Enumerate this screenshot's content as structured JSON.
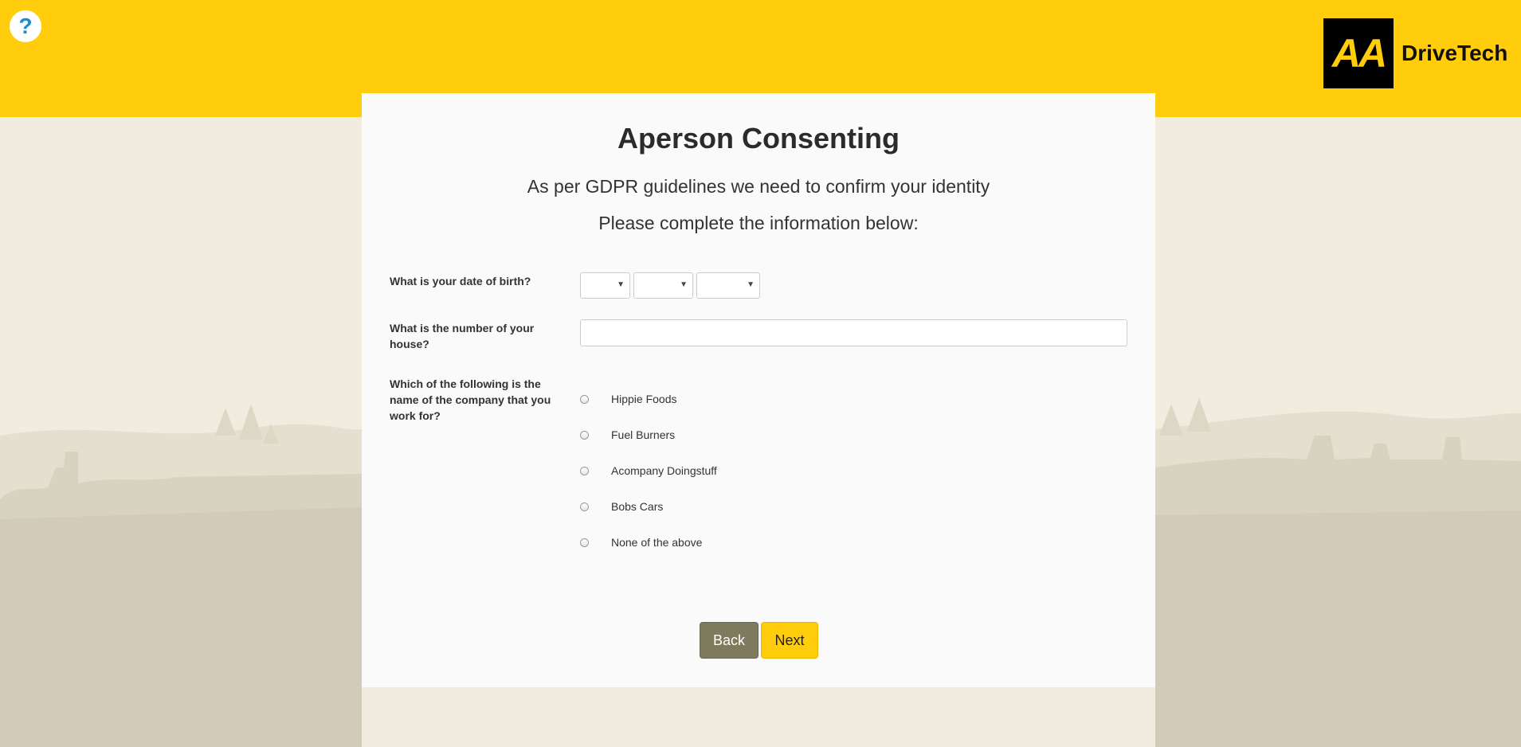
{
  "header": {
    "help_glyph": "?",
    "logo_mark": "AA",
    "logo_text": "DriveTech",
    "brand_color": "#ffcd0c"
  },
  "form": {
    "title": "Aperson Consenting",
    "subtitle_1": "As per GDPR guidelines we need to confirm your identity",
    "subtitle_2": "Please complete the information below:",
    "dob_label": "What is your date of birth?",
    "dob_day_value": "",
    "dob_month_value": "",
    "dob_year_value": "",
    "house_label": "What is the number of your house?",
    "house_value": "",
    "company_label": "Which of the following is the name of the company that you work for?",
    "company_options": [
      "Hippie Foods",
      "Fuel Burners",
      "Acompany Doingstuff",
      "Bobs Cars",
      "None of the above"
    ],
    "back_label": "Back",
    "next_label": "Next"
  }
}
